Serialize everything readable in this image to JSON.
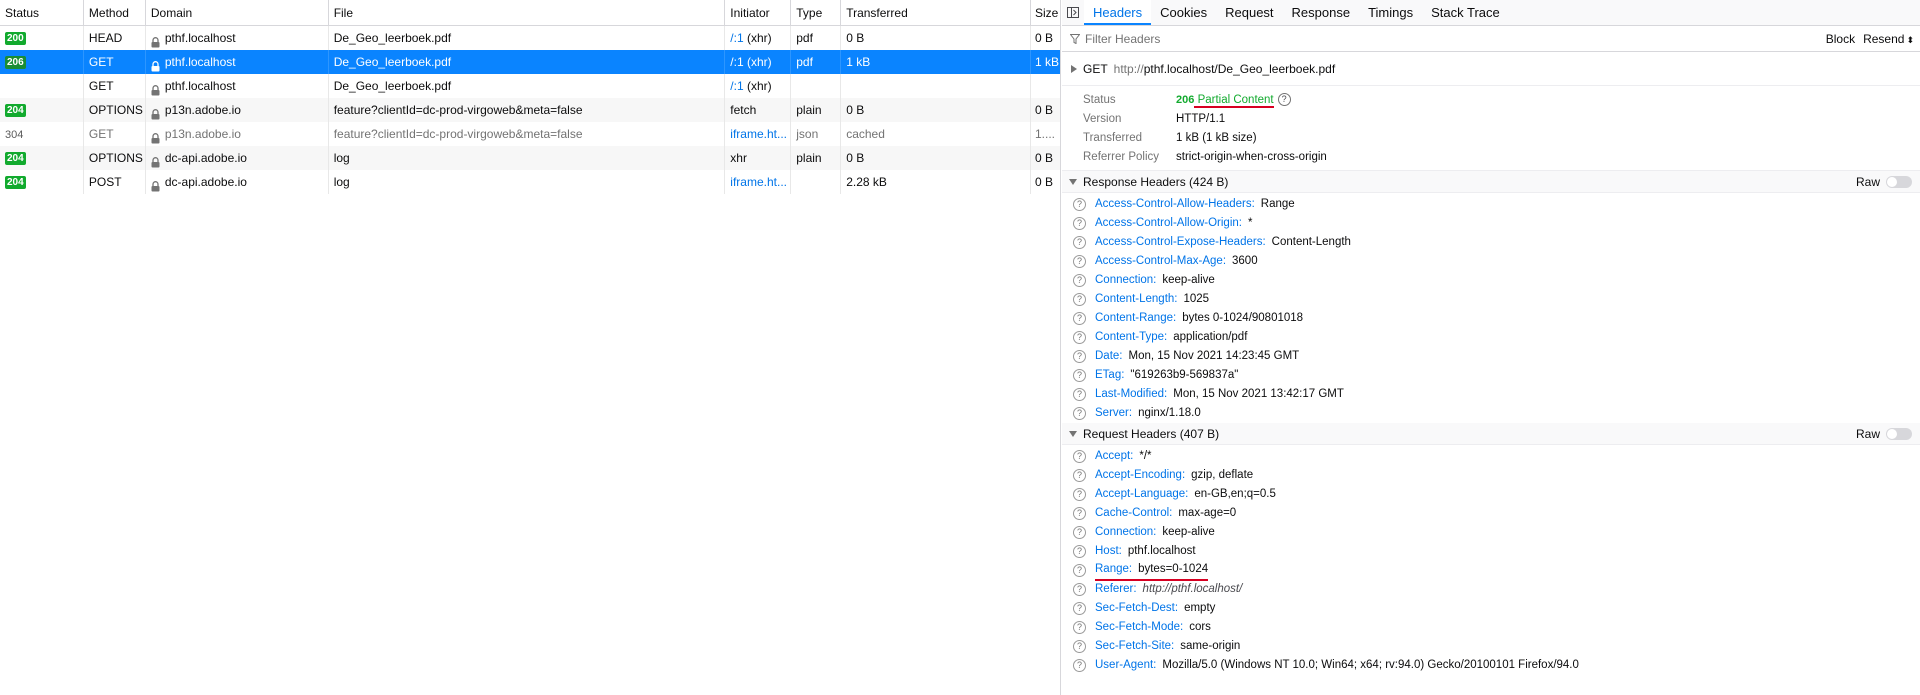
{
  "columns": {
    "status": "Status",
    "method": "Method",
    "domain": "Domain",
    "file": "File",
    "initiator": "Initiator",
    "type": "Type",
    "transferred": "Transferred",
    "size": "Size"
  },
  "requests": [
    {
      "status": "200",
      "method": "HEAD",
      "domain": "pthf.localhost",
      "file": "De_Geo_leerboek.pdf",
      "initiator_link": "/:1",
      "initiator_rest": " (xhr)",
      "type": "pdf",
      "transferred": "0 B",
      "size": "0 B"
    },
    {
      "status": "206",
      "method": "GET",
      "domain": "pthf.localhost",
      "file": "De_Geo_leerboek.pdf",
      "initiator_link": "/:1",
      "initiator_rest": " (xhr)",
      "type": "pdf",
      "transferred": "1 kB",
      "size": "1 kB"
    },
    {
      "status": "",
      "method": "GET",
      "domain": "pthf.localhost",
      "file": "De_Geo_leerboek.pdf",
      "initiator_link": "/:1",
      "initiator_rest": " (xhr)",
      "type": "",
      "transferred": "",
      "size": ""
    },
    {
      "status": "204",
      "method": "OPTIONS",
      "domain": "p13n.adobe.io",
      "file": "feature?clientId=dc-prod-virgoweb&meta=false",
      "initiator_link": "",
      "initiator_rest": "fetch",
      "type": "plain",
      "transferred": "0 B",
      "size": "0 B"
    },
    {
      "status": "304",
      "method": "GET",
      "domain": "p13n.adobe.io",
      "file": "feature?clientId=dc-prod-virgoweb&meta=false",
      "initiator_link": "iframe.ht...",
      "initiator_rest": "",
      "type": "json",
      "transferred": "cached",
      "size": "1...."
    },
    {
      "status": "204",
      "method": "OPTIONS",
      "domain": "dc-api.adobe.io",
      "file": "log",
      "initiator_link": "",
      "initiator_rest": "xhr",
      "type": "plain",
      "transferred": "0 B",
      "size": "0 B"
    },
    {
      "status": "204",
      "method": "POST",
      "domain": "dc-api.adobe.io",
      "file": "log",
      "initiator_link": "iframe.ht...",
      "initiator_rest": "",
      "type": "",
      "transferred": "2.28 kB",
      "size": "0 B"
    }
  ],
  "tabs": [
    "Headers",
    "Cookies",
    "Request",
    "Response",
    "Timings",
    "Stack Trace"
  ],
  "filter": {
    "placeholder": "Filter Headers",
    "block": "Block",
    "resend": "Resend"
  },
  "summary": {
    "method": "GET",
    "url_prefix": "http://",
    "url_rest": "pthf.localhost/De_Geo_leerboek.pdf"
  },
  "overview": {
    "status_label": "Status",
    "status_code": "206",
    "status_text": "Partial Content",
    "version_label": "Version",
    "version": "HTTP/1.1",
    "transferred_label": "Transferred",
    "transferred": "1 kB (1 kB size)",
    "referrer_label": "Referrer Policy",
    "referrer": "strict-origin-when-cross-origin"
  },
  "response_headers": {
    "title": "Response Headers (424 B)",
    "raw": "Raw",
    "items": [
      {
        "name": "Access-Control-Allow-Headers:",
        "value": "Range"
      },
      {
        "name": "Access-Control-Allow-Origin:",
        "value": "*"
      },
      {
        "name": "Access-Control-Expose-Headers:",
        "value": "Content-Length"
      },
      {
        "name": "Access-Control-Max-Age:",
        "value": "3600"
      },
      {
        "name": "Connection:",
        "value": "keep-alive"
      },
      {
        "name": "Content-Length:",
        "value": "1025"
      },
      {
        "name": "Content-Range:",
        "value": "bytes 0-1024/90801018"
      },
      {
        "name": "Content-Type:",
        "value": "application/pdf"
      },
      {
        "name": "Date:",
        "value": "Mon, 15 Nov 2021 14:23:45 GMT"
      },
      {
        "name": "ETag:",
        "value": "\"619263b9-569837a\""
      },
      {
        "name": "Last-Modified:",
        "value": "Mon, 15 Nov 2021 13:42:17 GMT"
      },
      {
        "name": "Server:",
        "value": "nginx/1.18.0"
      }
    ]
  },
  "request_headers": {
    "title": "Request Headers (407 B)",
    "raw": "Raw",
    "items": [
      {
        "name": "Accept:",
        "value": "*/*"
      },
      {
        "name": "Accept-Encoding:",
        "value": "gzip, deflate"
      },
      {
        "name": "Accept-Language:",
        "value": "en-GB,en;q=0.5"
      },
      {
        "name": "Cache-Control:",
        "value": "max-age=0"
      },
      {
        "name": "Connection:",
        "value": "keep-alive"
      },
      {
        "name": "Host:",
        "value": "pthf.localhost"
      },
      {
        "name": "Range:",
        "value": "bytes=0-1024"
      },
      {
        "name": "Referer:",
        "value": "http://pthf.localhost/"
      },
      {
        "name": "Sec-Fetch-Dest:",
        "value": "empty"
      },
      {
        "name": "Sec-Fetch-Mode:",
        "value": "cors"
      },
      {
        "name": "Sec-Fetch-Site:",
        "value": "same-origin"
      },
      {
        "name": "User-Agent:",
        "value": "Mozilla/5.0 (Windows NT 10.0; Win64; x64; rv:94.0) Gecko/20100101 Firefox/94.0"
      }
    ]
  },
  "colors": {
    "selected_row": "#0a84ff",
    "status_ok": "#12aa2e",
    "header_name": "#0074e8",
    "annotation_underline": "#d70022"
  },
  "icons": {
    "lock": "lock-icon",
    "panel_toggle": "panel-toggle-icon",
    "filter": "filter-icon",
    "help": "help-icon",
    "collapse": "triangle-down-icon",
    "expand": "triangle-right-icon"
  }
}
